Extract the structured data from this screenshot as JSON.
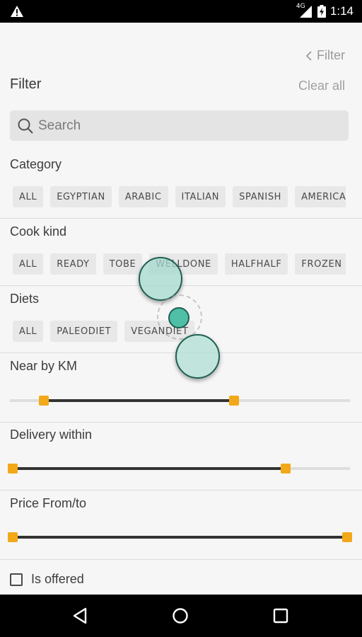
{
  "status_bar": {
    "time": "1:14",
    "network": "4G",
    "icons": [
      "warning-icon",
      "signal-icon",
      "battery-charging-icon"
    ]
  },
  "header": {
    "back_label": "Filter",
    "title": "Filter",
    "clear_all": "Clear all"
  },
  "search": {
    "placeholder": "Search",
    "value": ""
  },
  "sections": {
    "category": {
      "title": "Category",
      "chips": [
        "ALL",
        "EGYPTIAN",
        "ARABIC",
        "ITALIAN",
        "SPANISH",
        "AMERICAN"
      ]
    },
    "cook_kind": {
      "title": "Cook kind",
      "chips": [
        "ALL",
        "READY",
        "TOBE",
        "WELLDONE",
        "HALFHALF",
        "FROZEN"
      ]
    },
    "diets": {
      "title": "Diets",
      "chips": [
        "ALL",
        "PALEODIET",
        "VEGANDIET"
      ]
    },
    "near_by": {
      "title": "Near by KM",
      "range": [
        0.1,
        0.66
      ]
    },
    "delivery": {
      "title": "Delivery within",
      "range": [
        0.0,
        0.81
      ]
    },
    "price": {
      "title": "Price From/to",
      "range": [
        0.0,
        1.0
      ]
    }
  },
  "offered": {
    "label": "Is offered",
    "checked": false
  },
  "colors": {
    "accent": "#f2a818",
    "touch": "#7cc9b8",
    "background": "#f6f6f6"
  },
  "nav_bar": {
    "icons": [
      "back-icon",
      "home-icon",
      "recents-icon"
    ]
  }
}
